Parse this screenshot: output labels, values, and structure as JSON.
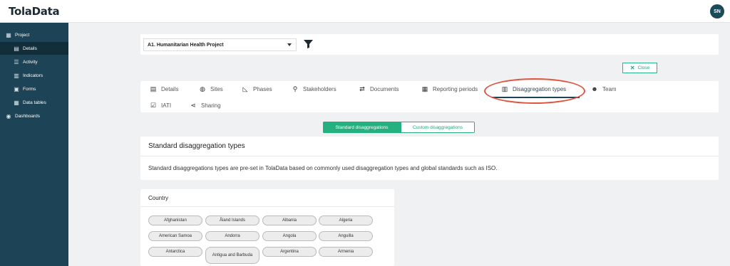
{
  "app": {
    "logo": "TolaData",
    "user_initials": "SN"
  },
  "sidebar": {
    "items": [
      {
        "label": "Project",
        "icon": "grid-icon"
      },
      {
        "label": "Details",
        "icon": "clipboard-icon",
        "active": true
      },
      {
        "label": "Activity",
        "icon": "list-icon"
      },
      {
        "label": "Indicators",
        "icon": "bar-chart-icon"
      },
      {
        "label": "Forms",
        "icon": "form-icon"
      },
      {
        "label": "Data tables",
        "icon": "table-icon"
      },
      {
        "label": "Dashboards",
        "icon": "dashboard-icon"
      }
    ]
  },
  "project_select": {
    "value": "A1. Humanitarian Health Project"
  },
  "close_label": "Close",
  "tabs": [
    {
      "label": "Details",
      "icon": "clipboard-icon"
    },
    {
      "label": "Sites",
      "icon": "globe-icon"
    },
    {
      "label": "Phases",
      "icon": "area-chart-icon"
    },
    {
      "label": "Stakeholders",
      "icon": "sitemap-icon"
    },
    {
      "label": "Documents",
      "icon": "exchange-icon"
    },
    {
      "label": "Reporting periods",
      "icon": "calendar-icon"
    },
    {
      "label": "Disaggregation types",
      "icon": "layers-icon",
      "active": true
    },
    {
      "label": "Team",
      "icon": "users-icon"
    },
    {
      "label": "IATI",
      "icon": "checkbox-icon"
    },
    {
      "label": "Sharing",
      "icon": "share-icon"
    }
  ],
  "segments": {
    "standard": "Standard disaggregations",
    "custom": "Custom disaggregations"
  },
  "section": {
    "title": "Standard disaggregation types",
    "description": "Standard disaggregations types are pre-set in TolaData based on commonly used disaggregation types and global standards such as ISO."
  },
  "country": {
    "title": "Country",
    "chips": [
      "Afghanistan",
      "Åland Islands",
      "Albania",
      "Algeria",
      "American Samoa",
      "Andorra",
      "Angola",
      "Anguilla",
      "Antarctica",
      "Antigua and Barbuda",
      "Argentina",
      "Armenia"
    ]
  },
  "colors": {
    "sidebar": "#1d4356",
    "accent": "#25b07f",
    "highlight": "#e0533f"
  }
}
